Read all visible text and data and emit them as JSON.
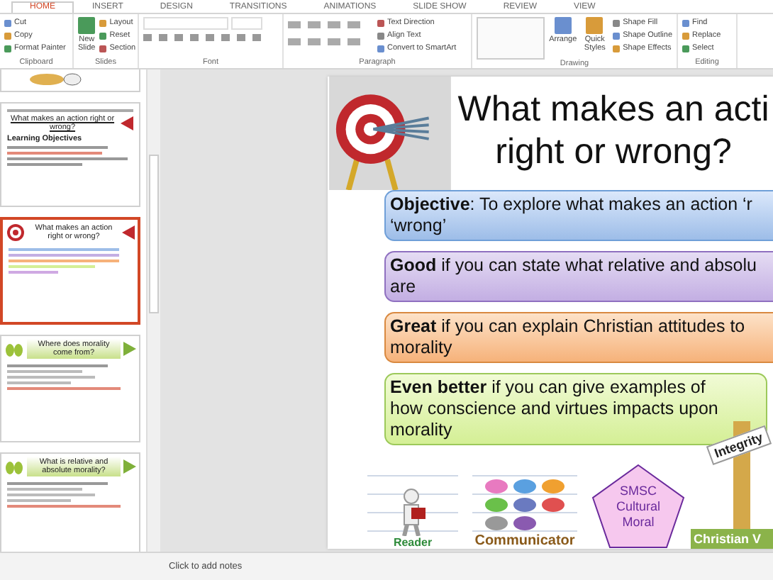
{
  "ribbon": {
    "tabs": [
      {
        "label": "HOME",
        "selected": true
      },
      {
        "label": "INSERT",
        "selected": false
      },
      {
        "label": "DESIGN",
        "selected": false
      },
      {
        "label": "TRANSITIONS",
        "selected": false
      },
      {
        "label": "ANIMATIONS",
        "selected": false
      },
      {
        "label": "SLIDE SHOW",
        "selected": false
      },
      {
        "label": "REVIEW",
        "selected": false
      },
      {
        "label": "VIEW",
        "selected": false
      }
    ],
    "groups": [
      {
        "label": "Clipboard",
        "kind": "buttons",
        "items": [
          {
            "label": "Cut",
            "kind": "small"
          },
          {
            "label": "Copy",
            "kind": "small"
          },
          {
            "label": "Format Painter",
            "kind": "small"
          }
        ]
      },
      {
        "label": "Slides",
        "kind": "buttons",
        "items": [
          {
            "label": "New Slide",
            "kind": "large"
          },
          {
            "label": "Layout",
            "kind": "small"
          },
          {
            "label": "Reset",
            "kind": "small"
          },
          {
            "label": "Section",
            "kind": "small"
          }
        ]
      },
      {
        "label": "Font",
        "kind": "font"
      },
      {
        "label": "Paragraph",
        "kind": "paragraph",
        "items": [
          {
            "label": "Text Direction",
            "kind": "small"
          },
          {
            "label": "Align Text",
            "kind": "small"
          },
          {
            "label": "Convert to SmartArt",
            "kind": "small"
          }
        ]
      },
      {
        "label": "Drawing",
        "kind": "shapes",
        "items": [
          {
            "label": "Arrange",
            "kind": "large"
          },
          {
            "label": "Quick Styles",
            "kind": "large"
          },
          {
            "label": "Shape Fill",
            "kind": "small"
          },
          {
            "label": "Shape Outline",
            "kind": "small"
          },
          {
            "label": "Shape Effects",
            "kind": "small"
          }
        ]
      },
      {
        "label": "Editing",
        "kind": "buttons",
        "items": [
          {
            "label": "Find",
            "kind": "small"
          },
          {
            "label": "Replace",
            "kind": "small"
          },
          {
            "label": "Select",
            "kind": "small"
          }
        ]
      }
    ]
  },
  "thumbnails": [
    {
      "kind": "partial",
      "selected": false
    },
    {
      "kind": "intro",
      "title": "What makes an action right or wrong?",
      "subtitle": "Learning Objectives",
      "selected": false
    },
    {
      "kind": "target",
      "title": "What makes an action right or wrong?",
      "selected": true
    },
    {
      "kind": "banner",
      "title": "Where does morality come from?",
      "selected": false
    },
    {
      "kind": "banner",
      "title": "What is relative and absolute morality?",
      "selected": false
    }
  ],
  "slide": {
    "title_lines": [
      "What makes an acti",
      "right or wrong?"
    ],
    "boxes": [
      {
        "kind": "objective",
        "lines": [
          "**Objective**: To explore what makes an action ‘r",
          "‘wrong’"
        ]
      },
      {
        "kind": "good",
        "lines": [
          "**Good** if you can state what relative and absolu",
          "are"
        ]
      },
      {
        "kind": "great",
        "lines": [
          "**Great** if you can explain Christian attitudes to",
          "morality"
        ]
      },
      {
        "kind": "better",
        "lines": [
          "**Even better** if you can give examples of",
          "how conscience and virtues impacts upon",
          "morality"
        ]
      }
    ],
    "badges": {
      "reader": "Reader",
      "communicator": "Communicator",
      "smsc": [
        "SMSC",
        "Cultural",
        "Moral"
      ],
      "sign": "Integrity",
      "values": "Christian V"
    }
  },
  "notes": {
    "placeholder": "Click to add notes"
  }
}
